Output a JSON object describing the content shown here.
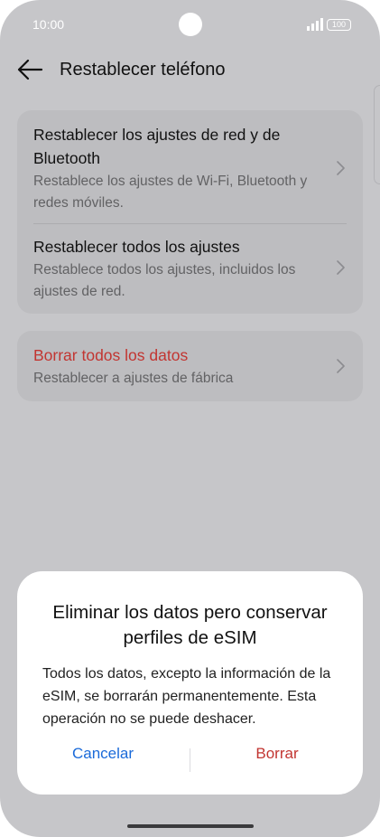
{
  "status_bar": {
    "time": "10:00",
    "battery": "100",
    "signal_icon": "signal-icon",
    "camera_icon": "camera-icon"
  },
  "app_bar": {
    "title": "Restablecer teléfono",
    "back_icon": "arrow-left-icon"
  },
  "settings": {
    "items": [
      {
        "title": "Restablecer los ajustes de red y de Bluetooth",
        "subtitle": "Restablece los ajustes de Wi-Fi, Bluetooth y redes móviles."
      },
      {
        "title": "Restablecer todos los ajustes",
        "subtitle": "Restablece todos los ajustes, incluidos los ajustes de red."
      },
      {
        "title": "Borrar todos los datos",
        "subtitle": "Restablecer a ajustes de fábrica"
      }
    ],
    "chevron_icon": "chevron-right-icon"
  },
  "dialog": {
    "title": "Eliminar los datos pero conservar perfiles de eSIM",
    "message": "Todos los datos, excepto la información de la eSIM, se borrarán permanentemente. Esta operación no se puede deshacer.",
    "cancel_label": "Cancelar",
    "confirm_label": "Borrar"
  },
  "colors": {
    "accent": "#1a6ad9",
    "danger": "#c23531",
    "scrim_background": "#c6c6c9",
    "dialog_background": "#ffffff"
  }
}
